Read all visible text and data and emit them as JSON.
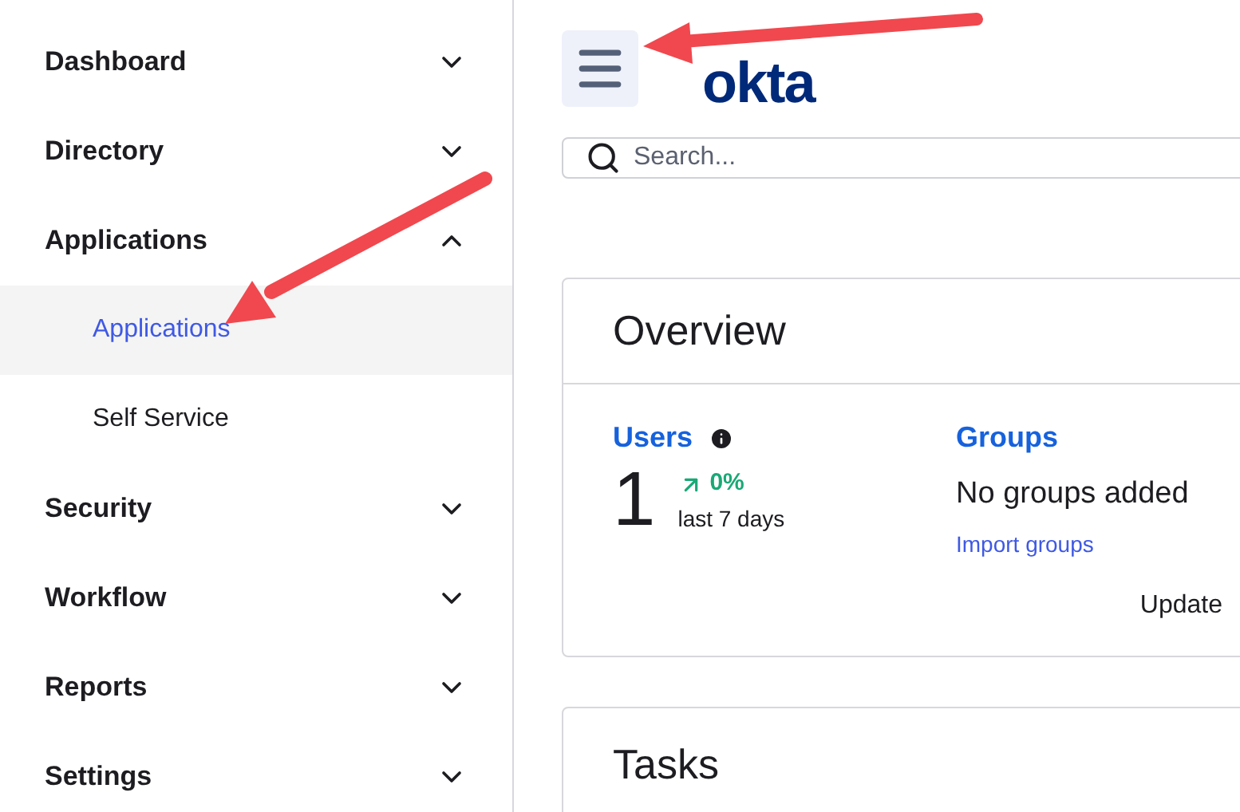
{
  "sidebar": {
    "items": [
      {
        "label": "Dashboard",
        "expanded": false
      },
      {
        "label": "Directory",
        "expanded": false
      },
      {
        "label": "Applications",
        "expanded": true,
        "children": [
          {
            "label": "Applications",
            "selected": true
          },
          {
            "label": "Self Service",
            "selected": false
          }
        ]
      },
      {
        "label": "Security",
        "expanded": false
      },
      {
        "label": "Workflow",
        "expanded": false
      },
      {
        "label": "Reports",
        "expanded": false
      },
      {
        "label": "Settings",
        "expanded": false
      }
    ]
  },
  "header": {
    "logo": "okta"
  },
  "search": {
    "placeholder": "Search..."
  },
  "overview": {
    "title": "Overview",
    "users": {
      "label": "Users",
      "count": "1",
      "change": "0%",
      "period": "last 7 days"
    },
    "groups": {
      "label": "Groups",
      "text": "No groups added",
      "link": "Import groups"
    },
    "footer": "Update"
  },
  "tasks": {
    "title": "Tasks"
  }
}
